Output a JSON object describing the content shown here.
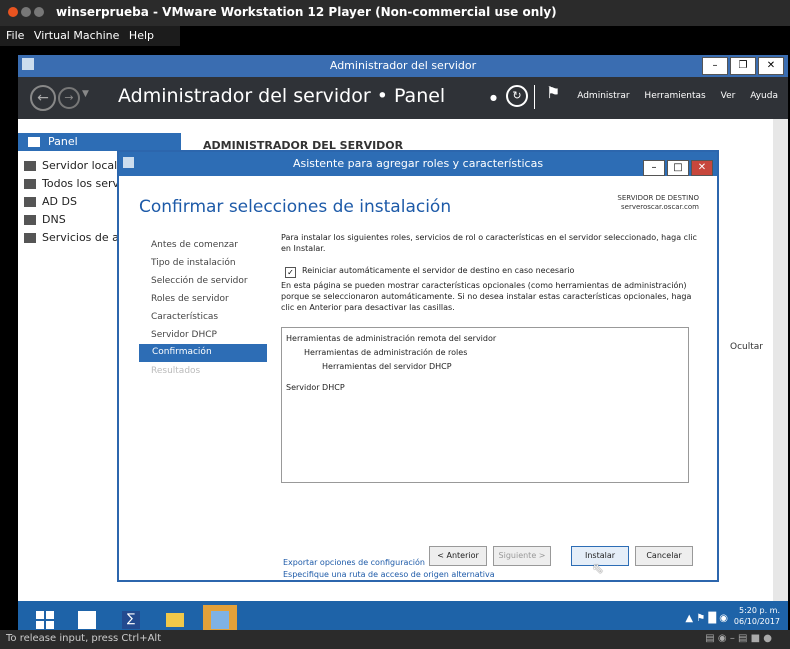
{
  "vmware": {
    "title": "winserprueba - VMware Workstation 12 Player (Non-commercial use only)",
    "menu": [
      "File",
      "Virtual Machine",
      "Help"
    ],
    "status_text": "To release input, press Ctrl+Alt"
  },
  "server_manager": {
    "window_title": "Administrador del servidor",
    "breadcrumb": "Administrador del servidor • Panel",
    "header_menu": [
      "Administrar",
      "Herramientas",
      "Ver",
      "Ayuda"
    ],
    "sidebar": [
      "Panel",
      "Servidor local",
      "Todos los servi",
      "AD DS",
      "DNS",
      "Servicios de ar"
    ],
    "main_heading": "ADMINISTRADOR DEL SERVIDOR",
    "ocultar": "Ocultar"
  },
  "wizard": {
    "title": "Asistente para agregar roles y características",
    "heading": "Confirmar selecciones de instalación",
    "dest_label": "SERVIDOR DE DESTINO",
    "dest_server": "serveroscar.oscar.com",
    "steps": [
      "Antes de comenzar",
      "Tipo de instalación",
      "Selección de servidor",
      "Roles de servidor",
      "Características",
      "Servidor DHCP",
      "Confirmación",
      "Resultados"
    ],
    "active_step": "Confirmación",
    "intro": "Para instalar los siguientes roles, servicios de rol o características en el servidor seleccionado, haga clic en Instalar.",
    "checkbox_label": "Reiniciar automáticamente el servidor de destino en caso necesario",
    "checkbox_checked": true,
    "optional_text": "En esta página se pueden mostrar características opcionales (como herramientas de administración) porque se seleccionaron automáticamente. Si no desea instalar estas características opcionales, haga clic en Anterior para desactivar las casillas.",
    "selections": [
      "Herramientas de administración remota del servidor",
      "Herramientas de administración de roles",
      "Herramientas del servidor DHCP",
      "Servidor DHCP"
    ],
    "link_export": "Exportar opciones de configuración",
    "link_source": "Especifique una ruta de acceso de origen alternativa",
    "btn_prev": "< Anterior",
    "btn_next": "Siguiente >",
    "btn_install": "Instalar",
    "btn_cancel": "Cancelar"
  },
  "taskbar": {
    "time": "5:20 p. m.",
    "date": "06/10/2017"
  }
}
